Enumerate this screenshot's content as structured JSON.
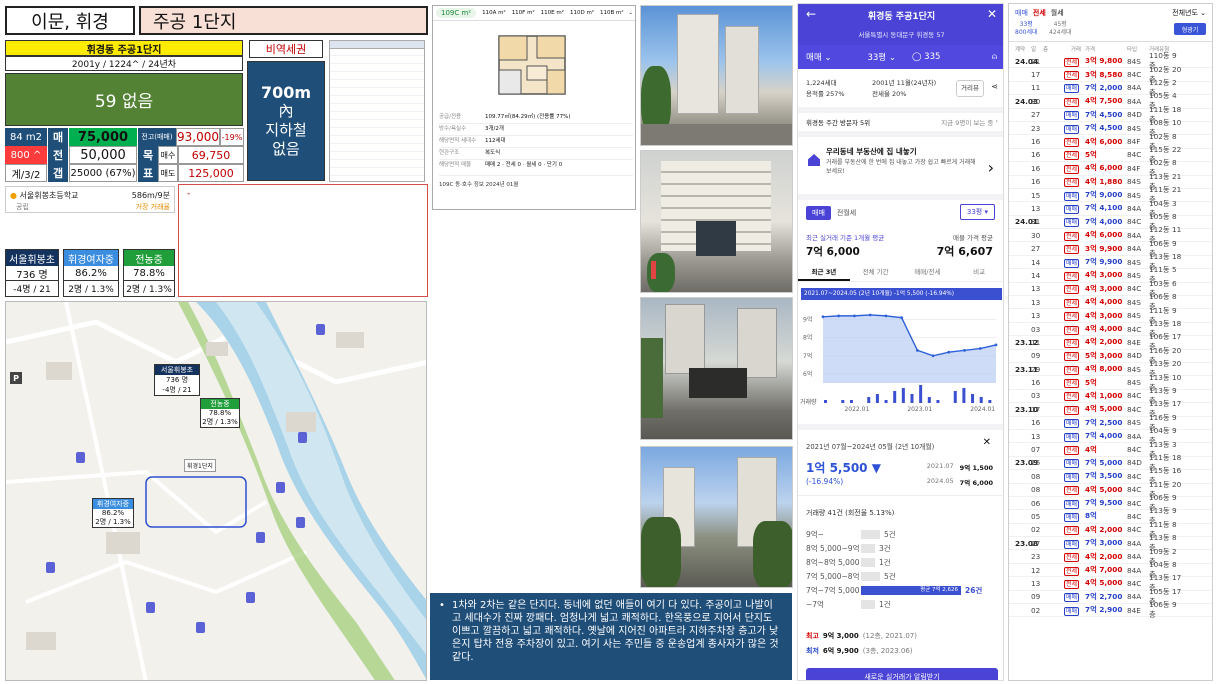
{
  "header": {
    "region": "이문, 휘경",
    "complex": "주공 1단지"
  },
  "info": {
    "name": "휘경동 주공1단지",
    "sub": "2001y / 1224^ / 24년차",
    "badge": "비역세권",
    "big": "59 없음",
    "station": {
      "dist": "700m",
      "inner": "內",
      "line1": "지하철",
      "line2": "없음"
    }
  },
  "price_table": {
    "area": "84 m2",
    "units": "800 ^",
    "year": "계/3/2",
    "sale_label": "매",
    "sale": "75,000",
    "jeonse_label": "전",
    "jeonse": "50,000",
    "gap_label": "갭",
    "gap": "25000 (67%)",
    "prev_label": "전고(매매)",
    "prev": "93,000",
    "prev_pct": "-19%",
    "goal_label": "목",
    "buy_label": "매수",
    "buy": "69,750",
    "pyo_label": "표",
    "sell_label": "매도",
    "sell": "125,000"
  },
  "school": {
    "name": "서울휘봉초등학교",
    "dist": "586m/9분",
    "type": "공립",
    "note": "거장 거래율"
  },
  "red_note": "-",
  "school_stats": [
    {
      "name": "서울휘봉초",
      "n": "736 명",
      "d": "-4명 / 21",
      "color": "#13325e"
    },
    {
      "name": "휘경여자중",
      "n": "86.2%",
      "d": "2명 / 1.3%",
      "color": "#3b8de0"
    },
    {
      "name": "전농중",
      "n": "78.8%",
      "d": "2명 / 1.3%",
      "color": "#1f9e3a"
    }
  ],
  "map": {
    "l1": {
      "name": "서울휘봉초",
      "a": "736 명",
      "b": "-4명 / 21"
    },
    "l2": {
      "name": "전농중",
      "a": "78.8%",
      "b": "2명 / 1.3%"
    },
    "l3": {
      "name": "휘경여자중",
      "a": "86.2%",
      "b": "2명 / 1.3%"
    },
    "complex": "휘경1단지",
    "p": "P"
  },
  "floorplan": {
    "tabs": [
      "109C m²",
      "110A m²",
      "110F m²",
      "110E m²",
      "110D m²",
      "110B m²"
    ],
    "rows": [
      {
        "k": "공급/전용",
        "v": "109.77㎡(84.29㎡) (전용률 77%)"
      },
      {
        "k": "방수/욕실수",
        "v": "3개/2개"
      },
      {
        "k": "해당면적 세대수",
        "v": "112세대"
      },
      {
        "k": "현관구조",
        "v": "복도식"
      },
      {
        "k": "해당면적 매물",
        "v": "매매 2 · 전세 0 · 월세 0 · 단기 0"
      }
    ],
    "footer": "109C 동·호수 정보  2024년 01월"
  },
  "note": "1차와 2차는 같은 단지다. 동네에 없던 애들이 여기 다 있다. 주공이고 나발이고 세대수가 진짜 깡패다. 엄청나게 넓고 쾌적하다. 한옥풍으로 지어서 단지도 이쁘고 깔끔하고 넓고 쾌적하다. 옛날에 지어진 아파트라 지하주차장 층고가 낮은지 탑차 전용 주차장이 있고. 여기 사는 주민들 중 운송업계 종사자가 많은 것 같다.",
  "phone": {
    "title": "휘경동 주공1단지",
    "address": "서울특별시 동대문구 휘경동 57",
    "deal": "매매",
    "size": "33평",
    "comments": "335",
    "units": "1,224세대",
    "built": "2001년 11월(24년차)",
    "ratio1": "용적률 257%",
    "ratio2": "전세율 20%",
    "view_btn": "거리뷰",
    "visitors": "휘경동 주간 방문자 5위",
    "visitors_note": "지금 9명이 보는 중",
    "promo_title": "우리동네 부동산에 집 내놓기",
    "promo_body": "거래를 부동산에 한 번에 집 내놓고 가장 쉽고 빠르게 거래해보세요!",
    "tab_sale": "매매",
    "tab_rent": "전월세",
    "dd": "33평",
    "recent_label": "최근 실거래 기준 1개월 평균",
    "recent": "7억 6,000",
    "ask_label": "매물 가격 평균",
    "ask": "7억 6,607",
    "subtabs": [
      "최근 3년",
      "전체 기간",
      "매매/전세",
      "비교"
    ],
    "chart_banner": "2021.07~2024.05 (2년 10개월) -1억 5,500 (-16.94%)",
    "volume_label": "거래량",
    "period": "2021년 07월~2024년 05월 (2년 10개월)",
    "change": "1억 5,500 ▼",
    "change_pct": "(-16.94%)",
    "d1": "2021.07",
    "v1": "9억 1,500",
    "d2": "2024.05",
    "v2": "7억 6,000",
    "vol": "거래량 41건 (회전율 5.13%)",
    "hist": [
      {
        "label": "9억~",
        "count": "5건",
        "w": 0.19
      },
      {
        "label": "8억 5,000~9억",
        "count": "3건",
        "w": 0.12
      },
      {
        "label": "8억~8억 5,000",
        "count": "1건",
        "w": 0.04
      },
      {
        "label": "7억 5,000~8억",
        "count": "5건",
        "w": 0.19
      },
      {
        "label": "7억~7억 5,000",
        "count": "26건",
        "w": 1.0,
        "avg": "평균 7억 2,626"
      },
      {
        "label": "~7억",
        "count": "1건",
        "w": 0.04
      }
    ],
    "high_label": "최고",
    "high": "9억 3,000",
    "high_note": "(12층, 2021.07)",
    "low_label": "최저",
    "low": "6억 9,900",
    "low_note": "(3층, 2023.06)",
    "cta": "새로운 실거래가 알림받기"
  },
  "chart_data": {
    "type": "line",
    "x": [
      "2021.07",
      "2021.10",
      "2022.01",
      "2022.04",
      "2022.07",
      "2022.10",
      "2023.01",
      "2023.04",
      "2023.07",
      "2023.10",
      "2024.01",
      "2024.05"
    ],
    "values": [
      9.15,
      9.2,
      9.2,
      9.25,
      9.2,
      9.1,
      7.3,
      7.0,
      7.2,
      7.3,
      7.4,
      7.6
    ],
    "x_ticks": [
      "2022.01",
      "2023.01",
      "2024.01"
    ],
    "y_ticks": [
      "9억",
      "8억",
      "7억",
      "6억"
    ],
    "ylim": [
      5.5,
      9.8
    ],
    "volume": [
      1,
      0,
      1,
      1,
      0,
      2,
      3,
      1,
      4,
      5,
      3,
      6,
      2,
      1,
      0,
      4,
      5,
      3,
      2,
      1
    ]
  },
  "trades": {
    "tabs": [
      "매매",
      "전세",
      "월세"
    ],
    "year_filter": "전체년도",
    "size_top": "33평",
    "size_bottom": "800세대",
    "size2_top": "45평",
    "size2_bottom": "424세대",
    "toggle": "형광기",
    "cols": [
      "계약",
      "일",
      "층",
      "거래",
      "가격",
      "타입",
      "거래유형"
    ],
    "rows": [
      {
        "m": "24.04",
        "d": "21",
        "t": "전세",
        "p": "3억 9,800",
        "a": "84S",
        "f": "110동 9층"
      },
      {
        "m": "",
        "d": "17",
        "t": "전세",
        "p": "3억 8,580",
        "a": "84C",
        "f": "102동 20층"
      },
      {
        "m": "",
        "d": "11",
        "t": "매매",
        "p": "7억 2,000",
        "a": "84A",
        "f": "112동 2층"
      },
      {
        "m": "24.03",
        "d": "30",
        "t": "전세",
        "p": "4억 7,500",
        "a": "84A",
        "f": "105동 4층"
      },
      {
        "m": "",
        "d": "27",
        "t": "매매",
        "p": "7억 4,500",
        "a": "84D",
        "f": "111동 18층"
      },
      {
        "m": "",
        "d": "23",
        "t": "매매",
        "p": "7억 4,500",
        "a": "84S",
        "f": "108동 10층"
      },
      {
        "m": "",
        "d": "16",
        "t": "전세",
        "p": "4억 6,000",
        "a": "84F",
        "f": "102동 8층"
      },
      {
        "m": "",
        "d": "16",
        "t": "전세",
        "p": "5억",
        "a": "84C",
        "f": "115동 22층"
      },
      {
        "m": "",
        "d": "16",
        "t": "전세",
        "p": "4억 6,000",
        "a": "84F",
        "f": "102동 8층"
      },
      {
        "m": "",
        "d": "16",
        "t": "전세",
        "p": "4억 1,880",
        "a": "84S",
        "f": "113동 21층"
      },
      {
        "m": "",
        "d": "15",
        "t": "매매",
        "p": "7억 9,000",
        "a": "84S",
        "f": "111동 21층"
      },
      {
        "m": "",
        "d": "13",
        "t": "매매",
        "p": "7억 4,100",
        "a": "84A",
        "f": "104동 3층"
      },
      {
        "m": "24.01",
        "d": "31",
        "t": "매매",
        "p": "7억 4,000",
        "a": "84C",
        "f": "105동 8층"
      },
      {
        "m": "",
        "d": "30",
        "t": "전세",
        "p": "4억 6,000",
        "a": "84A",
        "f": "112동 11층"
      },
      {
        "m": "",
        "d": "27",
        "t": "전세",
        "p": "3억 9,900",
        "a": "84A",
        "f": "106동 9층"
      },
      {
        "m": "",
        "d": "14",
        "t": "매매",
        "p": "7억 9,900",
        "a": "84S",
        "f": "113동 18층"
      },
      {
        "m": "",
        "d": "14",
        "t": "전세",
        "p": "4억 3,000",
        "a": "84S",
        "f": "111동 5층"
      },
      {
        "m": "",
        "d": "13",
        "t": "전세",
        "p": "4억 3,000",
        "a": "84C",
        "f": "103동 6층"
      },
      {
        "m": "",
        "d": "13",
        "t": "전세",
        "p": "4억 4,000",
        "a": "84S",
        "f": "106동 8층"
      },
      {
        "m": "",
        "d": "13",
        "t": "전세",
        "p": "4억 3,000",
        "a": "84S",
        "f": "111동 9층"
      },
      {
        "m": "",
        "d": "03",
        "t": "전세",
        "p": "4억 4,000",
        "a": "84C",
        "f": "113동 18층"
      },
      {
        "m": "23.12",
        "d": "11",
        "t": "전세",
        "p": "4억 2,000",
        "a": "84E",
        "f": "106동 17층"
      },
      {
        "m": "",
        "d": "09",
        "t": "전세",
        "p": "5억 3,000",
        "a": "84D",
        "f": "116동 20층"
      },
      {
        "m": "23.11",
        "d": "29",
        "t": "전세",
        "p": "4억 8,000",
        "a": "84S",
        "f": "113동 20층"
      },
      {
        "m": "",
        "d": "16",
        "t": "전세",
        "p": "5억",
        "a": "84S",
        "f": "113동 10층"
      },
      {
        "m": "",
        "d": "03",
        "t": "전세",
        "p": "4억 1,000",
        "a": "84C",
        "f": "113동 9층"
      },
      {
        "m": "23.10",
        "d": "17",
        "t": "전세",
        "p": "4억 5,000",
        "a": "84C",
        "f": "113동 17층"
      },
      {
        "m": "",
        "d": "16",
        "t": "매매",
        "p": "7억 2,500",
        "a": "84S",
        "f": "116동 9층"
      },
      {
        "m": "",
        "d": "13",
        "t": "매매",
        "p": "7억 4,000",
        "a": "84A",
        "f": "104동 9층"
      },
      {
        "m": "",
        "d": "07",
        "t": "전세",
        "p": "4억",
        "a": "84C",
        "f": "113동 3층"
      },
      {
        "m": "23.09",
        "d": "25",
        "t": "매매",
        "p": "7억 5,000",
        "a": "84D",
        "f": "111동 18층"
      },
      {
        "m": "",
        "d": "08",
        "t": "매매",
        "p": "7억 3,500",
        "a": "84C",
        "f": "115동 16층"
      },
      {
        "m": "",
        "d": "08",
        "t": "전세",
        "p": "4억 5,000",
        "a": "84C",
        "f": "111동 20층"
      },
      {
        "m": "",
        "d": "06",
        "t": "매매",
        "p": "7억 9,500",
        "a": "84C",
        "f": "106동 9층"
      },
      {
        "m": "",
        "d": "05",
        "t": "매매",
        "p": "8억",
        "a": "84C",
        "f": "113동 9층"
      },
      {
        "m": "",
        "d": "02",
        "t": "전세",
        "p": "4억 2,000",
        "a": "84C",
        "f": "111동 8층"
      },
      {
        "m": "23.08",
        "d": "27",
        "t": "매매",
        "p": "7억 3,000",
        "a": "84A",
        "f": "113동 8층"
      },
      {
        "m": "",
        "d": "23",
        "t": "전세",
        "p": "4억 2,000",
        "a": "84A",
        "f": "109동 2층"
      },
      {
        "m": "",
        "d": "12",
        "t": "전세",
        "p": "4억 7,000",
        "a": "84A",
        "f": "104동 8층"
      },
      {
        "m": "",
        "d": "13",
        "t": "전세",
        "p": "4억 5,000",
        "a": "84C",
        "f": "113동 17층"
      },
      {
        "m": "",
        "d": "09",
        "t": "매매",
        "p": "7억 2,700",
        "a": "84A",
        "f": "105동 17층"
      },
      {
        "m": "",
        "d": "02",
        "t": "매매",
        "p": "7억 2,900",
        "a": "84E",
        "f": "106동 9층"
      }
    ]
  }
}
